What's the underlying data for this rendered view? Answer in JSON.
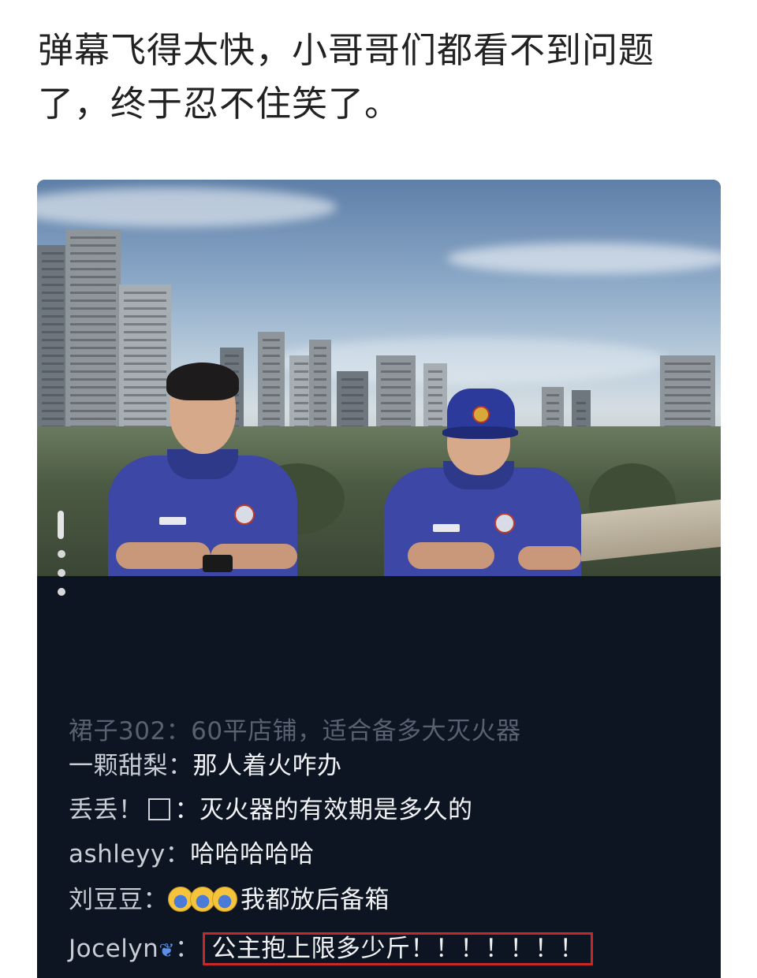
{
  "post": {
    "line1": "弹幕飞得太快，小哥哥们都看不到问题",
    "line2": "了，终于忍不住笑了。"
  },
  "comments": [
    {
      "user": "裙子302：",
      "text": "60平店铺，适合备多大灭火器"
    },
    {
      "user": "一颗甜梨：",
      "text": "那人着火咋办"
    },
    {
      "user": "丢丢！",
      "text": "：灭火器的有效期是多久的"
    },
    {
      "user": "ashleyy：",
      "text": "哈哈哈哈哈"
    },
    {
      "user": "刘豆豆：",
      "text": "我都放后备箱"
    },
    {
      "user": "Jocelyn",
      "icon": "butterfly-icon",
      "separator": "：",
      "text": "公主抱上限多少斤！！！！！！！"
    }
  ],
  "colors": {
    "uniform": "#3c47a6",
    "highlight_box": "#c62828",
    "comment_bg": "#0e1522"
  }
}
